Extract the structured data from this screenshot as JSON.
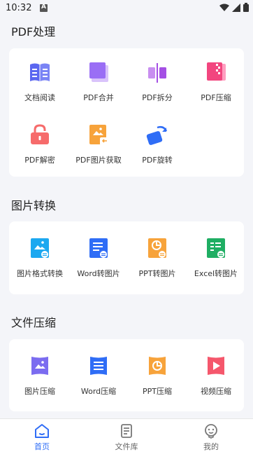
{
  "status": {
    "time": "10:32"
  },
  "sections": [
    {
      "title": "PDF处理",
      "tools": [
        {
          "label": "文档阅读",
          "icon": "book-reader-icon"
        },
        {
          "label": "PDF合并",
          "icon": "pdf-merge-icon"
        },
        {
          "label": "PDF拆分",
          "icon": "pdf-split-icon"
        },
        {
          "label": "PDF压缩",
          "icon": "pdf-compress-icon"
        },
        {
          "label": "PDF解密",
          "icon": "unlock-icon"
        },
        {
          "label": "PDF图片获取",
          "icon": "pdf-image-extract-icon"
        },
        {
          "label": "PDF旋转",
          "icon": "rotate-icon"
        }
      ]
    },
    {
      "title": "图片转换",
      "tools": [
        {
          "label": "图片格式转换",
          "icon": "image-convert-icon"
        },
        {
          "label": "Word转图片",
          "icon": "word-to-image-icon"
        },
        {
          "label": "PPT转图片",
          "icon": "ppt-to-image-icon"
        },
        {
          "label": "Excel转图片",
          "icon": "excel-to-image-icon"
        }
      ]
    },
    {
      "title": "文件压缩",
      "tools": [
        {
          "label": "图片压缩",
          "icon": "image-compress-icon"
        },
        {
          "label": "Word压缩",
          "icon": "word-compress-icon"
        },
        {
          "label": "PPT压缩",
          "icon": "ppt-compress-icon"
        },
        {
          "label": "视频压缩",
          "icon": "video-compress-icon"
        }
      ]
    }
  ],
  "tabs": [
    {
      "label": "首页",
      "icon": "home-icon",
      "active": true
    },
    {
      "label": "文件库",
      "icon": "file-library-icon",
      "active": false
    },
    {
      "label": "我的",
      "icon": "profile-icon",
      "active": false
    }
  ],
  "colors": {
    "accent": "#2f6df6",
    "tab_inactive": "#666666",
    "background": "#f4f5f9"
  }
}
